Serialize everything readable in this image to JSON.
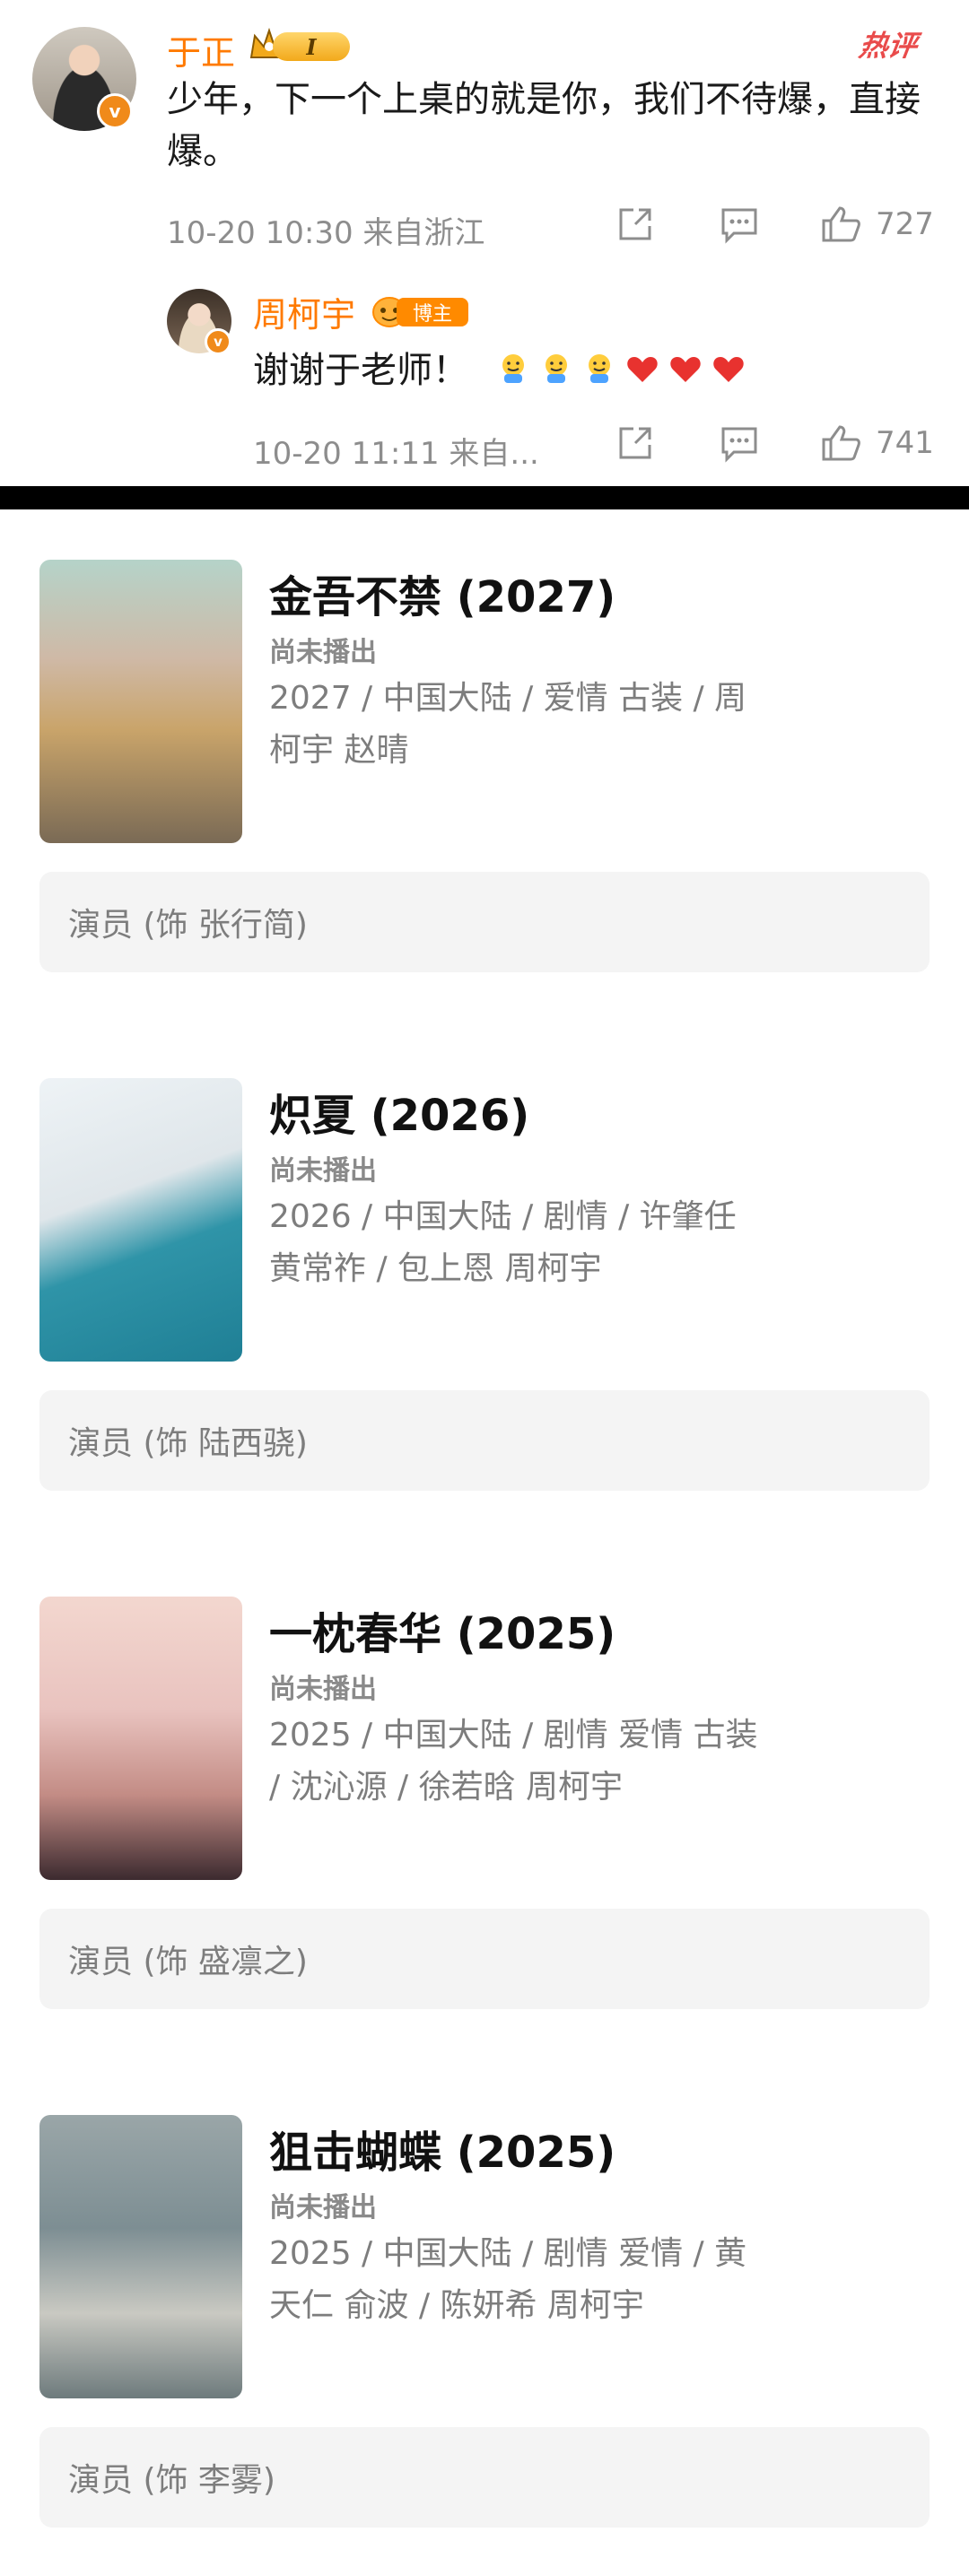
{
  "comment": {
    "username": "于正",
    "level_badge": "I",
    "hot_tag": "热评",
    "text": "少年，下一个上桌的就是你，我们不待爆，直接爆。",
    "meta": "10-20 10:30  来自浙江",
    "likes": "727"
  },
  "reply": {
    "username": "周柯宇",
    "badge_label": "博主",
    "text": "谢谢于老师！",
    "meta": "10-20 11:11  来自...",
    "likes": "741"
  },
  "works": [
    {
      "title": "金吾不禁 (2027)",
      "status": "尚未播出",
      "info": "2027 / 中国大陆 / 爱情 古装 / 周柯宇 赵晴",
      "role": "演员 (饰 张行简)"
    },
    {
      "title": "炽夏 (2026)",
      "status": "尚未播出",
      "info": "2026 / 中国大陆 / 剧情 / 许肇任 黄常祚 / 包上恩 周柯宇",
      "role": "演员 (饰 陆西骁)"
    },
    {
      "title": "一枕春华 (2025)",
      "status": "尚未播出",
      "info": "2025 / 中国大陆 / 剧情 爱情 古装 / 沈沁源 / 徐若晗 周柯宇",
      "role": "演员 (饰 盛凛之)"
    },
    {
      "title": "狙击蝴蝶 (2025)",
      "status": "尚未播出",
      "info": "2025 / 中国大陆 / 剧情 爱情 / 黄天仁 俞波 / 陈妍希 周柯宇",
      "role": "演员 (饰 李雾)"
    }
  ],
  "colors": {
    "username": "#ff7a00",
    "hot": "#e94b4b",
    "meta": "#8d8d8d",
    "role_bg": "#f4f4f4"
  },
  "icons": {
    "share": "share-icon",
    "comment": "comment-icon",
    "like": "like-icon",
    "emoji_face": "emoji-face-icon",
    "heart": "heart-icon"
  }
}
